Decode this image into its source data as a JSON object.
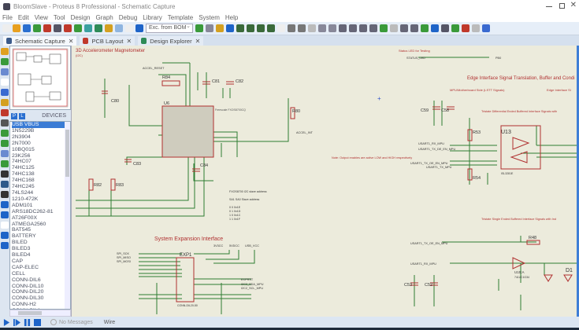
{
  "window": {
    "title": "BloomSlave - Proteus 8 Professional - Schematic Capture"
  },
  "menu": [
    "File",
    "Edit",
    "View",
    "Tool",
    "Design",
    "Graph",
    "Debug",
    "Library",
    "Template",
    "System",
    "Help"
  ],
  "toolbar": {
    "variant_select": "Exc. from BOM"
  },
  "tabs": [
    {
      "label": "Schematic Capture",
      "active": true,
      "color": "#3a5a8a"
    },
    {
      "label": "PCB Layout",
      "active": false,
      "color": "#c0392b"
    },
    {
      "label": "Design Explorer",
      "active": false,
      "color": "#2e8b57"
    }
  ],
  "devices": {
    "header": "DEVICES",
    "mode_p": "P",
    "mode_l": "L",
    "items": [
      "USB VBUS",
      "1N5229B",
      "2N3904",
      "2N7000",
      "10BQ015",
      "23K256",
      "74HC07",
      "74HC125",
      "74HC138",
      "74HC168",
      "74HC245",
      "74LS244",
      "1210-472K",
      "ADM101",
      "ARS18DC262-81",
      "AT26F00X",
      "ATMEGA2560",
      "BAT545",
      "BATTERY",
      "BILED",
      "BILED3",
      "BILED4",
      "CAP",
      "CAP-ELEC",
      "CELL",
      "CONN-DIL6",
      "CONN-DIL10",
      "CONN-DIL20",
      "CONN-DIL30",
      "CONN-H2",
      "CONN-SIL1"
    ],
    "selected_index": 0
  },
  "schematic": {
    "colors": {
      "wire": "#2e7d32",
      "part": "#b03030",
      "background": "#ecebdc"
    },
    "sections": {
      "accel": "3D Accelerometer Magnetometer",
      "accel_sub": "(I2C)",
      "expansion": "System Expansion Interface",
      "status_led": "Status LED for Testing",
      "edge": "Edge Interface Signal Translation, Buffer and Condi",
      "mpu": "MPU/Motherboard Side (LSTT Signals)",
      "edge_side": "Edge Interface Si",
      "tristate_diff": "Tristate Differential Ended Buffered Interface Signals with",
      "tristate_single": "Tristate Single Ended Buffered Interface Signals with Ind",
      "note_active_low": "Note: Output enables are active LOW and HIGH respectively"
    },
    "parts": {
      "u6": "U6",
      "u6_value": "Freescale FXOS8700CQ",
      "r84": "R84",
      "c81": "C81",
      "c82": "C82",
      "c80": "C80",
      "c83": "C83",
      "c84": "C84",
      "r82": "R82",
      "r83": "R83",
      "r80": "R80",
      "c59": "C59",
      "c58": "C58",
      "r53": "R53",
      "r54": "R54",
      "u13": "U13",
      "u13_value": "ISL3281E",
      "r48": "R48",
      "u15": "U15:A",
      "u15_value": "74LVC1G34",
      "d1": "D1",
      "c53": "C53",
      "c52": "C52",
      "exp1": "EXP1",
      "exp1_value": "CONN-DIL20-50"
    },
    "nets": {
      "accel_reset": "ACCEL_RESET",
      "accel_int": "ACCEL_INT",
      "status_led": "STATUS_LED",
      "pb0": "PB0",
      "usart1_rx": "USART1_RX_MPU",
      "usart1_tx": "USART1_TX_DE_EN_MPU",
      "usart1_txd": "USART1_TX_OE_EN_MPU",
      "usart1_t": "USART1_TX_MPU",
      "spi_sck": "SPI_SCK",
      "spi_miso": "SPI_MISO",
      "spi_mosi": "SPI_MOSI",
      "exp_rst": "EXPRST",
      "i2c_sda": "I2C2_SDA_MPU",
      "i2c_scl": "I2C2_SCL_MPU",
      "vcc33": "3V3CC",
      "vcc5": "5VDCC",
      "usb_vcc": "USB_VCC"
    },
    "address_note": [
      "FXOS8700 I2C slave address",
      "SA1 SA0 Slave address",
      "0 0 0x1E",
      "0 1 0x1D",
      "1 0 0x1C",
      "1 1 0x1F"
    ]
  },
  "status": {
    "messages": "No Messages",
    "sheet": "Wire"
  }
}
